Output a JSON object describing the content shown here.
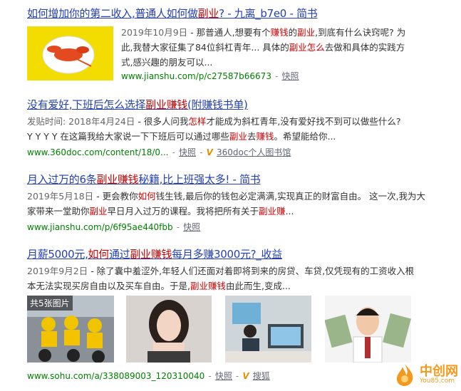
{
  "r1": {
    "title_a": "如何增加你的第二收入,普通人如何做",
    "title_hl": "副业",
    "title_b": "? - 九离_b7e0 - 简书",
    "date": "2019年10月9日",
    "abs_a": " - 那普通人,想要有个",
    "hl1": "赚钱",
    "abs_b": "的",
    "hl2": "副业",
    "abs_c": ",到底有什么诀窍呢? 为此,我替大家征集了84位斜杠青年... 具体的",
    "hl3": "副业怎么",
    "abs_d": "去做和具体的实践方式,感兴趣的朋友可以...",
    "url": "www.jianshu.com/p/c27587b66673",
    "snapshot": "快照"
  },
  "r2": {
    "title_a": "没有爱好,下班后怎么选择",
    "title_hl": "副业赚钱",
    "title_b": "(附赚钱书单)",
    "date": "发贴时间: 2018年4月24日",
    "abs_a": " - 很多人问我",
    "hl1": "怎样",
    "abs_b": "才能成为斜杠青年,没有爱好找不到可以做些什么?",
    "abs_c": "Y Y Y Y 在这篇我给大家说一下下班后可以通过哪些",
    "hl2": "副业",
    "abs_d": "去",
    "hl3": "赚钱",
    "abs_e": "。希望能给你...",
    "url": "www.360doc.com/content/18/0...",
    "snapshot": "快照",
    "source": "360doc个人图书馆"
  },
  "r3": {
    "title_a": "月入过万的6条",
    "title_hl": "副业赚钱",
    "title_b": "秘籍,比上班强太多! - 简书",
    "date": "2019年5月18日",
    "abs_a": " - 更会教你",
    "hl1": "如何",
    "abs_b": "钱生钱,最后你的钱包必定满满,实现真正的财富自由。 这一次,我为大家带来一堂助你",
    "hl2": "副业",
    "abs_c": "早日月入过万的课程。我将把所有关于",
    "hl3": "副业赚",
    "abs_d": "...",
    "url": "www.jianshu.com/p/6f95ae440fbb",
    "snapshot": "快照"
  },
  "r4": {
    "title_a": "月薪5000元,",
    "title_hl1": "如何",
    "title_b": "通过",
    "title_hl2": "副业赚钱",
    "title_c": "每月多赚3000元?_收益",
    "date": "2019年9月2日",
    "abs_a": " - 除了囊中羞涩外,年轻人们还面对着即将到来的房贷、车贷,仅凭现有的工资收入根本无法实现买房自由以及买车自由。于是,",
    "hl1": "副业赚钱",
    "abs_b": "由此而生,变成...",
    "images_label": "共5张图片",
    "url": "www.sohu.com/a/338089003_120310040",
    "snapshot": "快照",
    "source": "搜狐"
  },
  "watermark": {
    "brand": "中创网",
    "sub": "You85.com"
  },
  "colors": {
    "title": "#2440b3",
    "highlight": "#cc0000",
    "url": "#008000"
  }
}
